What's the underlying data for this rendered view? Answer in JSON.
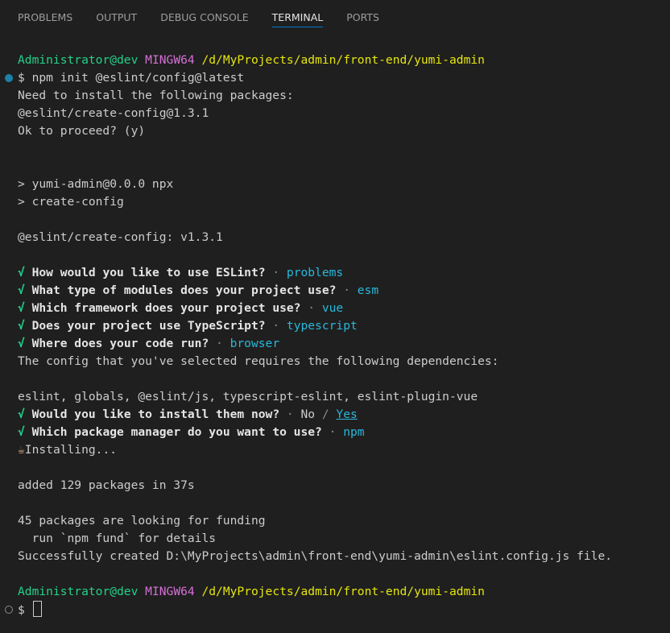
{
  "tabs": [
    {
      "label": "PROBLEMS"
    },
    {
      "label": "OUTPUT"
    },
    {
      "label": "DEBUG CONSOLE"
    },
    {
      "label": "TERMINAL",
      "active": true
    },
    {
      "label": "PORTS"
    }
  ],
  "terminal": {
    "prompt1": {
      "user": "Administrator@dev",
      "system": "MINGW64",
      "path": "/d/MyProjects/admin/front-end/yumi-admin"
    },
    "command": "$ npm init @eslint/config@latest",
    "need_install": "Need to install the following packages:",
    "package": "@eslint/create-config@1.3.1",
    "ok_proceed": "Ok to proceed? (y)",
    "npx_line1": "> yumi-admin@0.0.0 npx",
    "npx_line2": "> create-config",
    "create_config_version": "@eslint/create-config: v1.3.1",
    "questions": [
      {
        "check": "√",
        "question": "How would you like to use ESLint?",
        "sep": " · ",
        "answer": "problems"
      },
      {
        "check": "√",
        "question": "What type of modules does your project use?",
        "sep": " · ",
        "answer": "esm"
      },
      {
        "check": "√",
        "question": "Which framework does your project use?",
        "sep": " · ",
        "answer": "vue"
      },
      {
        "check": "√",
        "question": "Does your project use TypeScript?",
        "sep": " · ",
        "answer": "typescript"
      },
      {
        "check": "√",
        "question": "Where does your code run?",
        "sep": " · ",
        "answer": "browser"
      }
    ],
    "config_requires": "The config that you've selected requires the following dependencies:",
    "dependencies": "eslint, globals, @eslint/js, typescript-eslint, eslint-plugin-vue",
    "install_now": {
      "check": "√",
      "question": "Would you like to install them now?",
      "sep": " · ",
      "no": "No",
      "slash": " / ",
      "yes": "Yes"
    },
    "package_manager": {
      "check": "√",
      "question": "Which package manager do you want to use?",
      "sep": " · ",
      "answer": "npm"
    },
    "installing_emoji": "☕",
    "installing": "Installing...",
    "added": "added 129 packages in 37s",
    "funding": "45 packages are looking for funding",
    "run_fund": "  run `npm fund` for details",
    "success": "Successfully created D:\\MyProjects\\admin\\front-end\\yumi-admin\\eslint.config.js file.",
    "prompt2": {
      "user": "Administrator@dev",
      "system": "MINGW64",
      "path": "/d/MyProjects/admin/front-end/yumi-admin"
    },
    "final_prompt": "$ "
  },
  "colors": {
    "background": "#1f1f1f",
    "accent": "#0078d4",
    "user": "#23d18b",
    "system": "#d670d6",
    "path": "#e5e510",
    "answer": "#29b8db"
  }
}
